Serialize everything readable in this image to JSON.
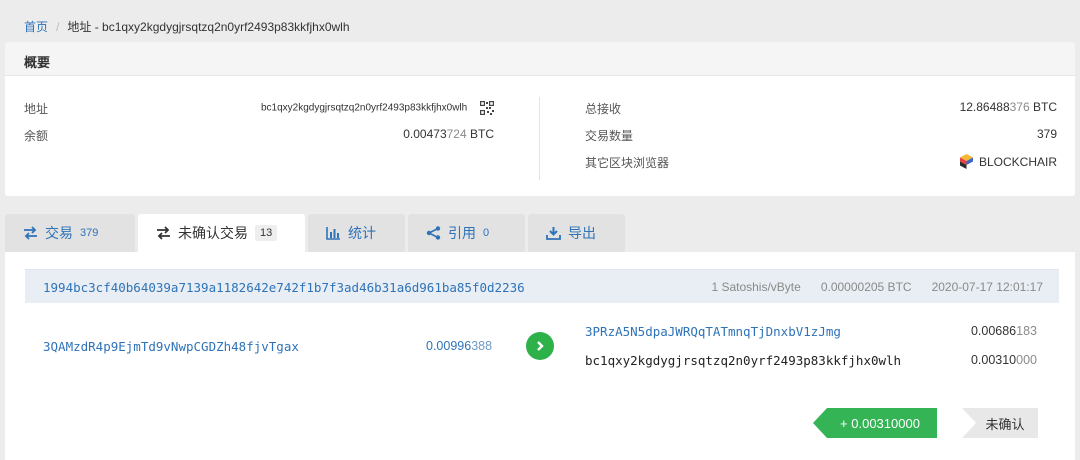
{
  "breadcrumb": {
    "home": "首页",
    "separator": "/",
    "current": "地址 - bc1qxy2kgdygjrsqtzq2n0yrf2493p83kkfjhx0wlh"
  },
  "summary": {
    "title": "概要",
    "address_label": "地址",
    "address_value": "bc1qxy2kgdygjrsqtzq2n0yrf2493p83kkfjhx0wlh",
    "balance_label": "余额",
    "balance_main": "0.00473",
    "balance_rest": "724",
    "balance_unit": " BTC",
    "total_received_label": "总接收",
    "total_received_main": "12.86488",
    "total_received_rest": "376",
    "total_received_unit": " BTC",
    "tx_count_label": "交易数量",
    "tx_count_value": "379",
    "other_explorer_label": "其它区块浏览器",
    "other_explorer_value": "BLOCKCHAIR"
  },
  "tabs": [
    {
      "label": "交易",
      "count": "379",
      "icon": "swap-icon"
    },
    {
      "label": "未确认交易",
      "count": "13",
      "icon": "swap-icon",
      "active": true
    },
    {
      "label": "统计",
      "count": "",
      "icon": "bar-chart-icon"
    },
    {
      "label": "引用",
      "count": "0",
      "icon": "share-icon"
    },
    {
      "label": "导出",
      "count": "",
      "icon": "download-icon"
    }
  ],
  "transaction": {
    "hash": "1994bc3cf40b64039a7139a1182642e742f1b7f3ad46b31a6d961ba85f0d2236",
    "fee_rate": "1 Satoshis/vByte",
    "fee": "0.00000205 BTC",
    "time": "2020-07-17 12:01:17",
    "input_address": "3QAMzdR4p9EjmTd9vNwpCGDZh48fjvTgax",
    "input_amount_main": "0.00996",
    "input_amount_rest": "388",
    "outputs": [
      {
        "address": "3PRzA5N5dpaJWRQqTATmnqTjDnxbV1zJmg",
        "amount_main": "0.00686",
        "amount_rest": "183"
      },
      {
        "address": "bc1qxy2kgdygjrsqtzq2n0yrf2493p83kkfjhx0wlh",
        "amount_main": "0.00310",
        "amount_rest": "000"
      }
    ],
    "net_change": "+ 0.00310000",
    "status": "未确认"
  },
  "colors": {
    "link": "#2f73b8",
    "positive": "#35b455",
    "header_bg": "#e8eef4"
  }
}
